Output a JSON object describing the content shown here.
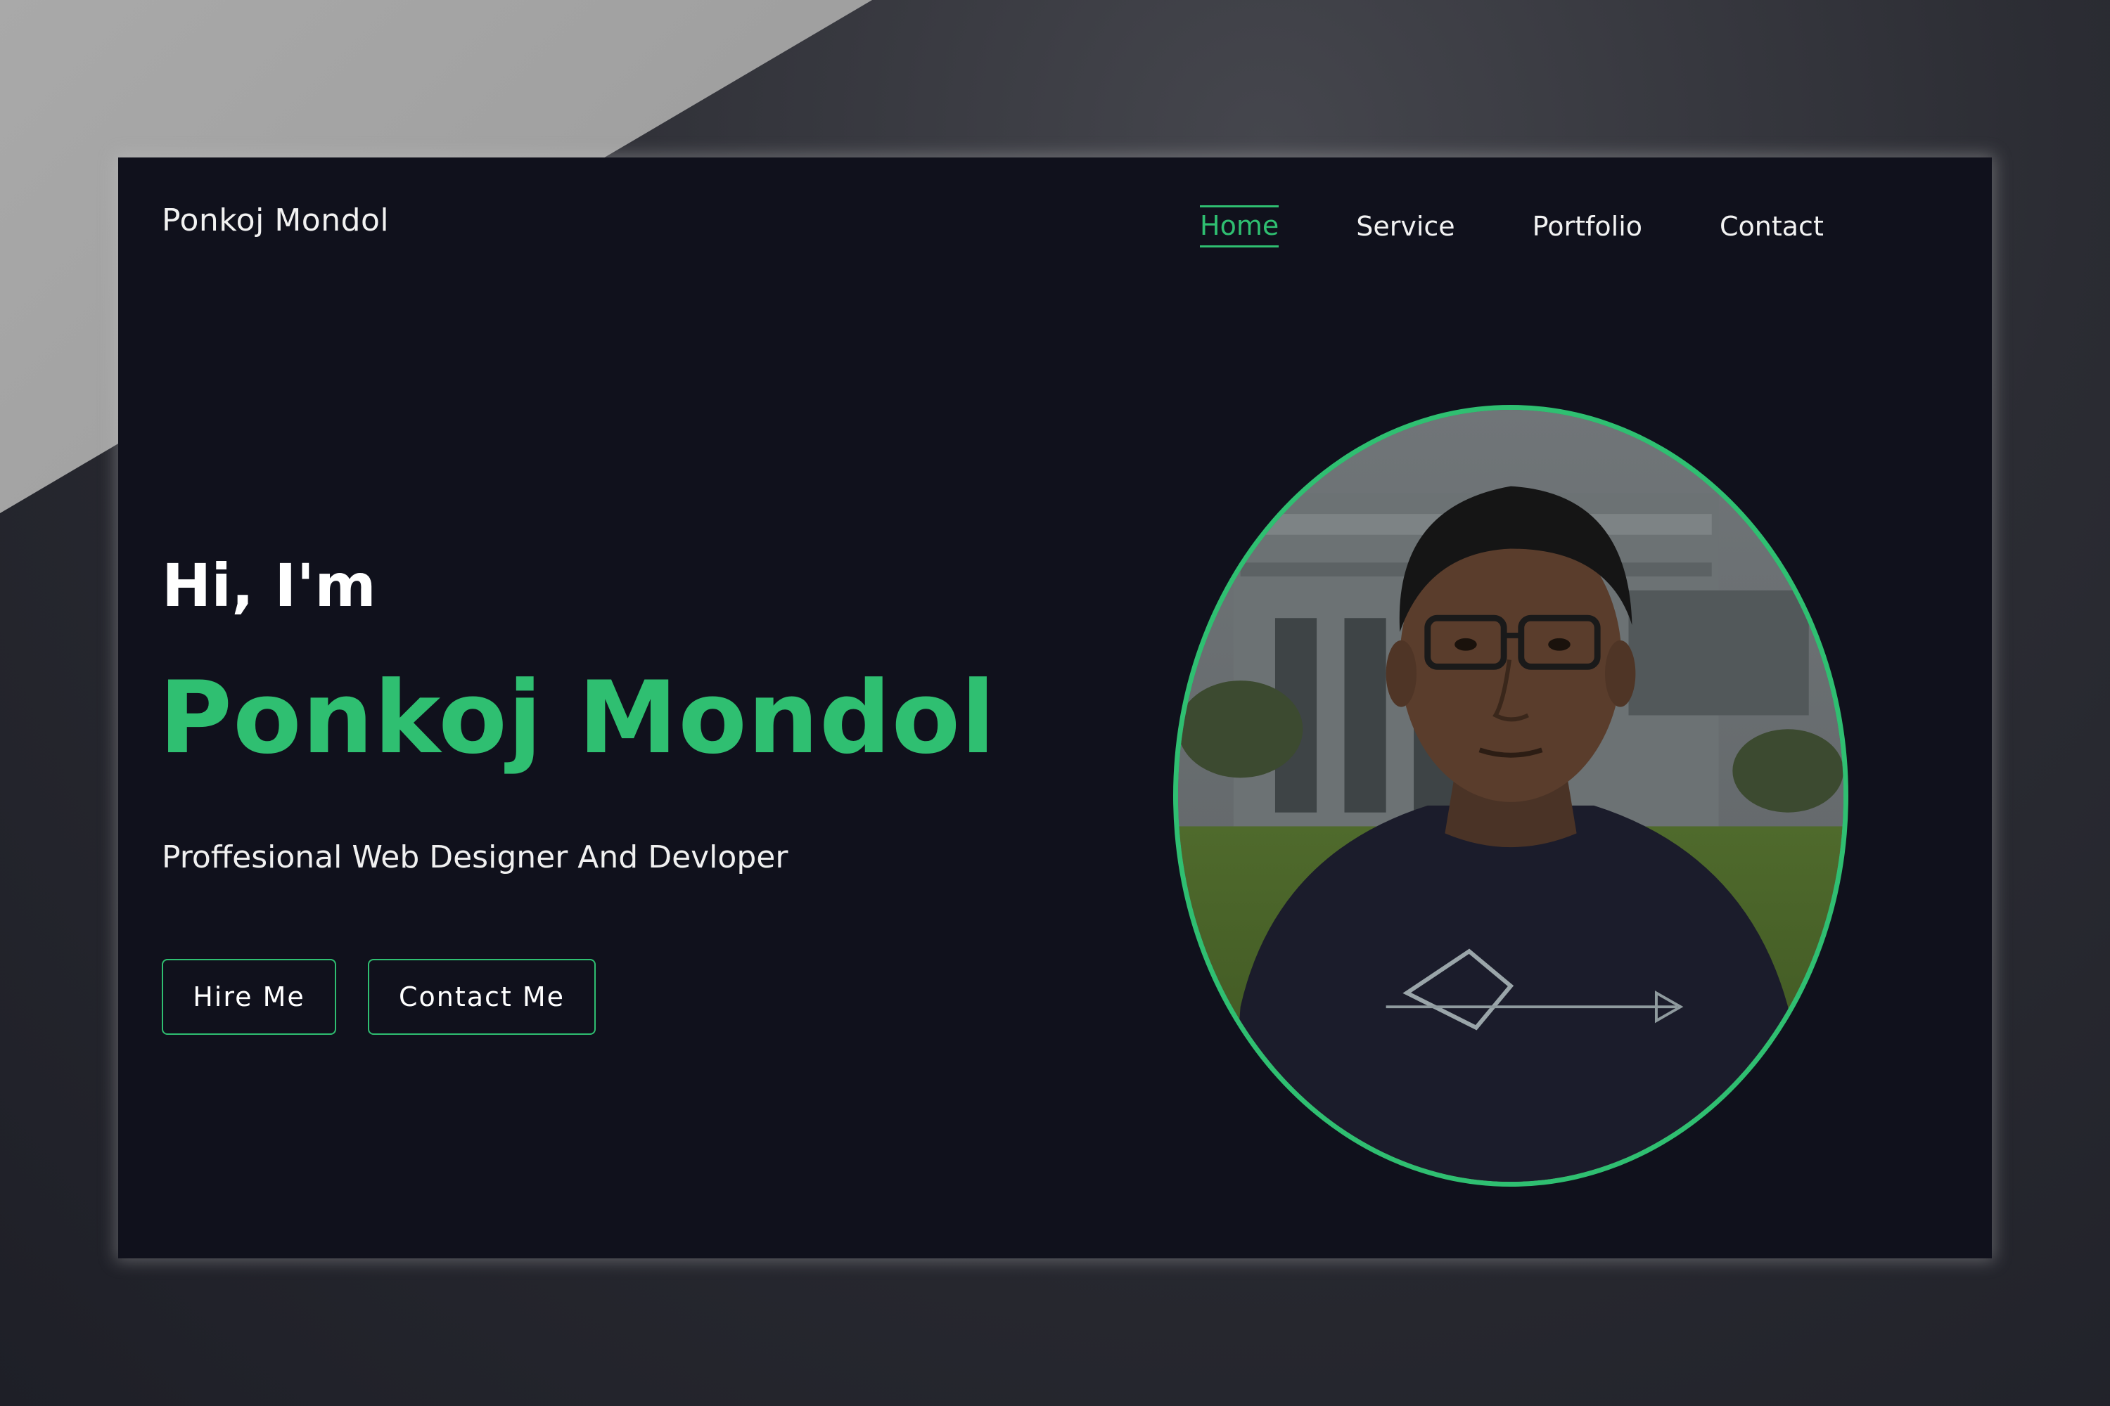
{
  "header": {
    "brand": "Ponkoj Mondol",
    "nav": [
      {
        "label": "Home",
        "active": true
      },
      {
        "label": "Service",
        "active": false
      },
      {
        "label": "Portfolio",
        "active": false
      },
      {
        "label": "Contact",
        "active": false
      }
    ]
  },
  "hero": {
    "greeting": "Hi, I'm",
    "name": "Ponkoj Mondol",
    "tagline": "Proffesional Web Designer And Devloper",
    "buttons": {
      "hire": "Hire Me",
      "contact": "Contact Me"
    }
  },
  "profile_photo": {
    "icon": "person-photo"
  },
  "colors": {
    "accent": "#2fbf71",
    "background": "#10111c",
    "text": "#ffffff"
  }
}
